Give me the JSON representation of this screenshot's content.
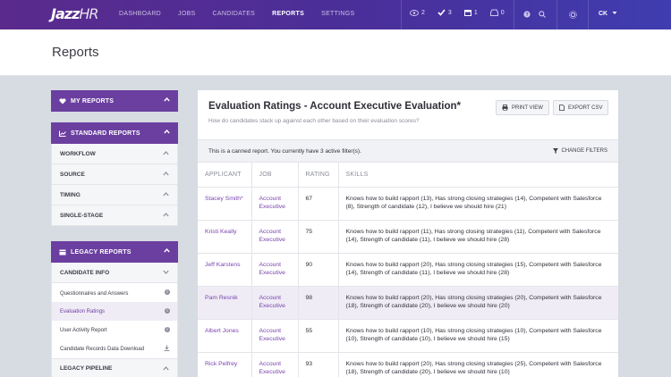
{
  "brand": {
    "logo_main": "Jazz",
    "logo_suffix": "HR"
  },
  "nav": {
    "links": [
      "DASHBOARD",
      "JOBS",
      "CANDIDATES",
      "REPORTS",
      "SETTINGS"
    ],
    "active": "REPORTS",
    "counts": {
      "views": "2",
      "tasks": "3",
      "calendar": "1",
      "inbox": "0"
    },
    "user": "CK"
  },
  "page": {
    "title": "Reports"
  },
  "sidebar": {
    "my_reports": "MY REPORTS",
    "standard_reports": "STANDARD REPORTS",
    "standard_items": [
      "WORKFLOW",
      "SOURCE",
      "TIMING",
      "SINGLE-STAGE"
    ],
    "legacy_reports": "LEGACY REPORTS",
    "candidate_info": "CANDIDATE INFO",
    "candidate_items": [
      "Questionnaires and Answers",
      "Evaluation Ratings",
      "User Activity Report",
      "Candidate Records Data Download"
    ],
    "legacy_pipeline": "LEGACY PIPELINE"
  },
  "report": {
    "title": "Evaluation Ratings - Account Executive Evaluation*",
    "subtitle": "How do candidates stack up against each other based on their evaluation scores?",
    "print_label": "PRINT VIEW",
    "export_label": "EXPORT CSV",
    "filter_text": "This is a canned report. You currently have 3 active filter(s).",
    "change_filters_label": "CHANGE FILTERS",
    "columns": [
      "APPLICANT",
      "JOB",
      "RATING",
      "SKILLS"
    ],
    "rows": [
      {
        "applicant": "Stacey Smith*",
        "job": "Account Executive",
        "rating": "67",
        "skills": "Knows how to build rapport (13), Has strong closing strategies (14), Competent with Salesforce (8), Strength of candidate (12), I believe we should hire (21)"
      },
      {
        "applicant": "Kristi Keally",
        "job": "Account Executive",
        "rating": "75",
        "skills": "Knows how to build rapport (11), Has strong closing strategies (11), Competent with Salesforce (14), Strength of candidate (11), I believe we should hire (28)"
      },
      {
        "applicant": "Jeff Karstens",
        "job": "Account Executive",
        "rating": "90",
        "skills": "Knows how to build rapport (20), Has strong closing strategies (15), Competent with Salesforce (14), Strength of candidate (11), I believe we should hire (28)"
      },
      {
        "applicant": "Pam Resnik",
        "job": "Account Executive",
        "rating": "98",
        "skills": "Knows how to build rapport (20), Has strong closing strategies (20), Competent with Salesforce (18), Strength of candidate (20), I believe we should hire (20)"
      },
      {
        "applicant": "Albert Jones",
        "job": "Account Executive",
        "rating": "55",
        "skills": "Knows how to build rapport (10), Has strong closing strategies (10), Competent with Salesforce (10), Strength of candidate (10), I believe we should hire (15)"
      },
      {
        "applicant": "Rick Pelfrey",
        "job": "Account Executive",
        "rating": "93",
        "skills": "Knows how to build rapport (20), Has strong closing strategies (25), Competent with Salesforce (18), Strength of candidate (20), I believe we should hire (10)"
      }
    ],
    "highlighted_row": 3
  },
  "colors": {
    "brand_purple": "#6b3fa0",
    "link_purple": "#7a45ad",
    "nav_start": "#5a2a8c",
    "nav_end": "#3f3db0"
  }
}
